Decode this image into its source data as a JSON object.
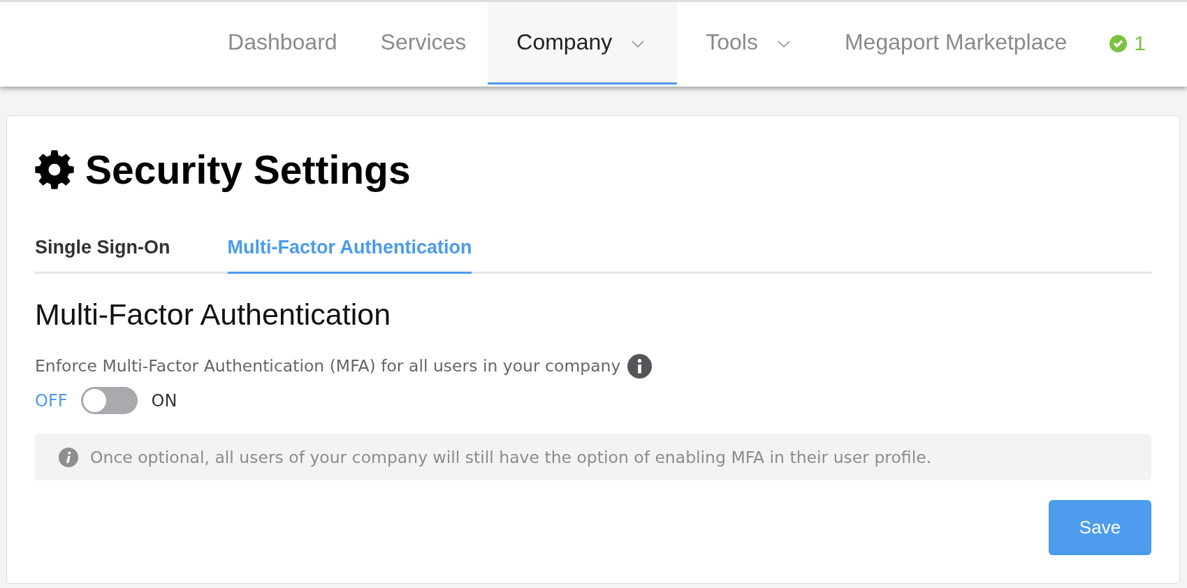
{
  "nav": {
    "items": [
      {
        "label": "Dashboard",
        "selected": false,
        "dropdown": false
      },
      {
        "label": "Services",
        "selected": false,
        "dropdown": false
      },
      {
        "label": "Company",
        "selected": true,
        "dropdown": true
      },
      {
        "label": "Tools",
        "selected": false,
        "dropdown": true
      },
      {
        "label": "Megaport Marketplace",
        "selected": false,
        "dropdown": false
      }
    ],
    "status": {
      "count": "1"
    }
  },
  "page": {
    "title": "Security Settings",
    "tabs": [
      {
        "label": "Single Sign-On",
        "selected": false
      },
      {
        "label": "Multi-Factor Authentication",
        "selected": true
      }
    ],
    "section": {
      "heading": "Multi-Factor Authentication",
      "description": "Enforce Multi-Factor Authentication (MFA) for all users in your company",
      "toggle": {
        "off_label": "OFF",
        "on_label": "ON",
        "on": false
      },
      "note": "Once optional, all users of your company will still have the option of enabling MFA in their user profile.",
      "save_button": "Save"
    }
  }
}
